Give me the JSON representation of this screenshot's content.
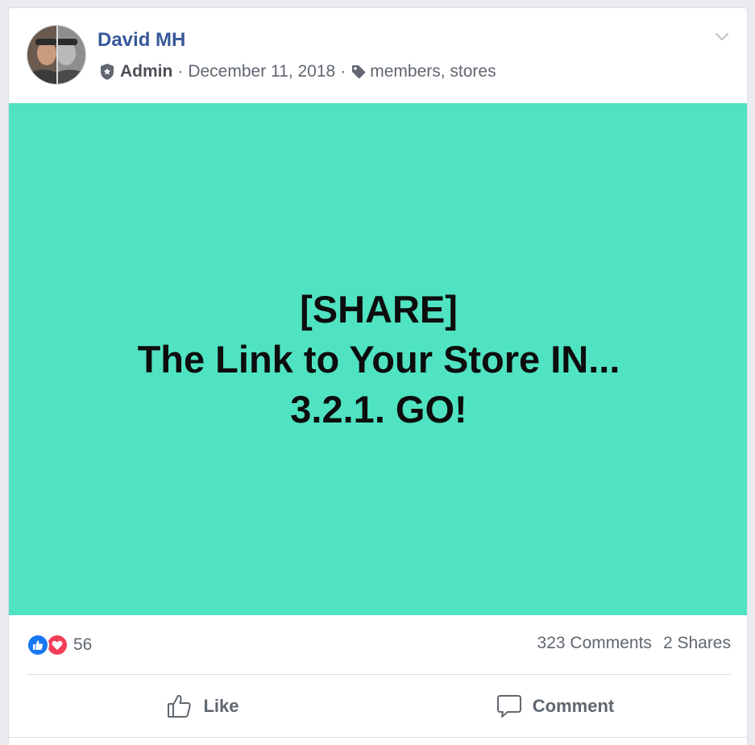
{
  "post": {
    "author": "David MH",
    "role": "Admin",
    "separator": "·",
    "date": "December 11, 2018",
    "tags": "members, stores"
  },
  "image": {
    "background_color": "#50e3c2",
    "lines": [
      "[SHARE]",
      "The Link to Your Store IN...",
      "3.2.1. GO!"
    ]
  },
  "stats": {
    "reaction_icons": [
      "like-icon",
      "love-icon"
    ],
    "reaction_count": "56",
    "comments": "323 Comments",
    "shares": "2 Shares"
  },
  "actions": {
    "like_label": "Like",
    "comment_label": "Comment"
  },
  "colors": {
    "author_link": "#385898",
    "like_blue": "#1877f2",
    "love_red": "#f33e58",
    "secondary_text": "#606770"
  }
}
